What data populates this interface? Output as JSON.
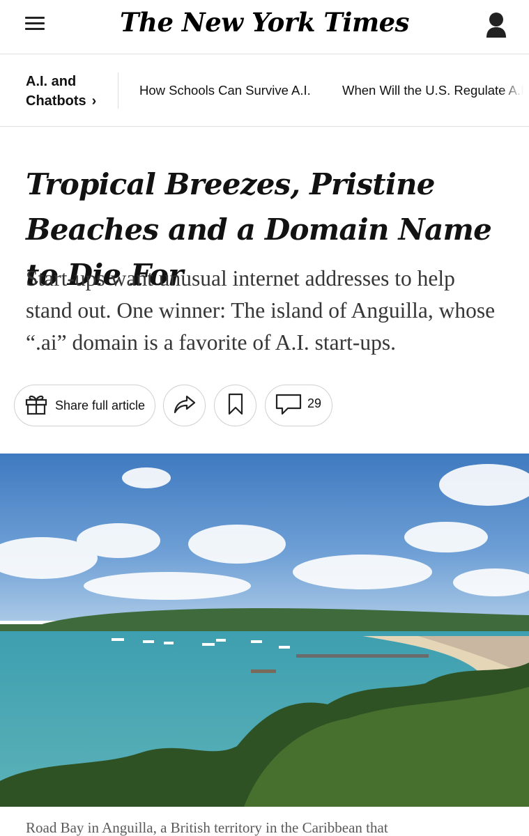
{
  "masthead": {
    "logo_text": "The New York Times",
    "menu_icon": "hamburger-menu-icon",
    "account_icon": "user-account-icon"
  },
  "section_nav": {
    "section_label": "A.I. and Chatbots",
    "chevron": "›",
    "links": [
      {
        "label": "How Schools Can Survive A.I."
      },
      {
        "label": "When Will the U.S. Regulate A.I."
      }
    ]
  },
  "article": {
    "headline": "Tropical Breezes, Pristine Beaches and a Domain Name to Die For",
    "summary": "Start-ups want unusual internet addresses to help stand out. One winner: The island of Anguilla, whose “.ai” domain is a favorite of A.I. start-ups.",
    "actions": {
      "share_label": "Share full article",
      "share_icon": "gift-icon",
      "forward_icon": "share-arrow-icon",
      "save_icon": "bookmark-icon",
      "comments_icon": "comment-bubble-icon",
      "comment_count": "29"
    },
    "image_caption": "Road Bay in Anguilla, a British territory in the Caribbean that"
  },
  "colors": {
    "text": "#121212",
    "summary_text": "#363636",
    "divider": "#dfdfdf",
    "sky": "#4f86c4",
    "sea": "#4fa9b3"
  }
}
